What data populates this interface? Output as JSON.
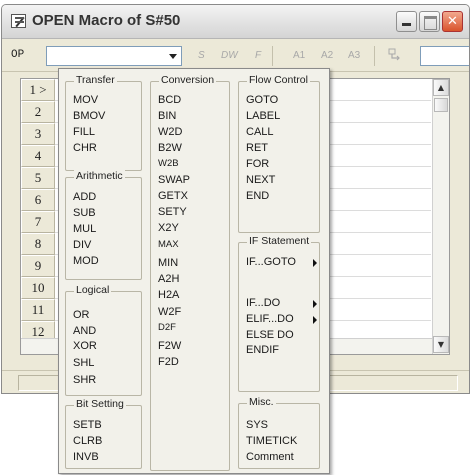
{
  "window": {
    "title": "OPEN Macro of S#50"
  },
  "toolbar": {
    "op_label": "OP",
    "op_value": "",
    "tools": [
      "S",
      "DW",
      "F",
      "A1",
      "A2",
      "A3"
    ]
  },
  "grid": {
    "rows": [
      "1 >",
      "2",
      "3",
      "4",
      "5",
      "6",
      "7",
      "8",
      "9",
      "10",
      "11",
      "12"
    ]
  },
  "menu": {
    "transfer": {
      "label": "Transfer",
      "items": [
        "MOV",
        "BMOV",
        "FILL",
        "CHR"
      ]
    },
    "arithmetic": {
      "label": "Arithmetic",
      "items": [
        "ADD",
        "SUB",
        "MUL",
        "DIV",
        "MOD"
      ]
    },
    "logical": {
      "label": "Logical",
      "items": [
        "OR",
        "AND",
        "XOR",
        "SHL",
        "SHR"
      ]
    },
    "bit_setting": {
      "label": "Bit Setting",
      "items": [
        "SETB",
        "CLRB",
        "INVB"
      ]
    },
    "conversion": {
      "label": "Conversion",
      "items": [
        "BCD",
        "BIN",
        "W2D",
        "B2W",
        "W2B",
        "SWAP",
        "GETX",
        "SETY",
        "X2Y",
        "MAX",
        "MIN",
        "A2H",
        "H2A",
        "W2F",
        "D2F",
        "F2W",
        "F2D"
      ]
    },
    "flow_control": {
      "label": "Flow Control",
      "items": [
        "GOTO",
        "LABEL",
        "CALL",
        "RET",
        "FOR",
        "NEXT",
        "END"
      ]
    },
    "if_statement": {
      "label": "IF Statement",
      "items": [
        "IF...GOTO",
        "IF...DO",
        "ELIF...DO",
        "ELSE DO",
        "ENDIF"
      ]
    },
    "misc": {
      "label": "Misc.",
      "items": [
        "SYS",
        "TIMETICK",
        "Comment"
      ]
    }
  },
  "colors": {
    "window_bg": "#ece9d8",
    "close_button": "#d9532c"
  }
}
